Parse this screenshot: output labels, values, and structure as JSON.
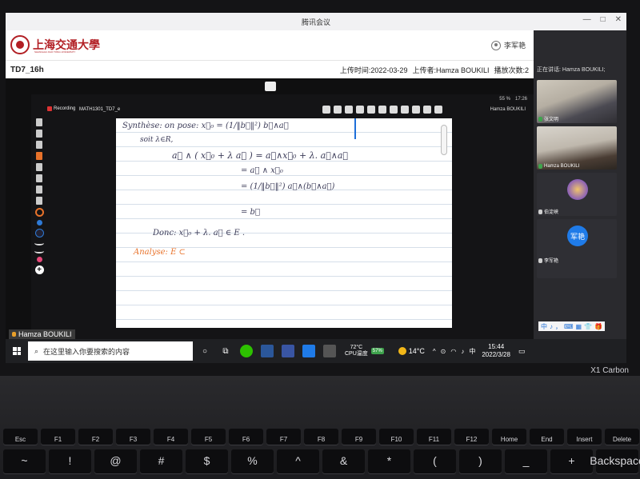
{
  "window": {
    "title": "腾讯会议",
    "controls": [
      "—",
      "□",
      "✕"
    ]
  },
  "header": {
    "logo_text": "上海交通大學",
    "logo_subtext": "SHANGHAI JIAO TONG UNIVERSITY",
    "user_name": "李军艳"
  },
  "info_bar": {
    "course_title": "TD7_16h",
    "upload_time": "上传时间:2022-03-29",
    "uploader": "上传者:Hamza BOUKILI",
    "play_count": "播放次数:2"
  },
  "whiteboard": {
    "recording_label": "Recording",
    "doc_name": "MATH1301_TD7_e",
    "presenter": "Hamza BOUKILI",
    "status_battery": "55 %",
    "status_time": "17:26",
    "math_lines": [
      "Synthèse:  on pose:  x⃗₀ = (1/‖b⃗‖²) b⃗∧a⃗",
      "soit λ∈R,",
      "a⃗ ∧ ( x⃗₀ + λ a⃗ )  =  a⃗∧x⃗₀  +  λ. a⃗∧a⃗",
      "=  a⃗ ∧ x⃗₀",
      "=  (1/‖b⃗‖²)  a⃗∧(b⃗∧a⃗)",
      "=  b⃗",
      "Donc:   x⃗₀ + λ. a⃗  ∈  E .",
      "Analyse:    E ⊂"
    ]
  },
  "participants": {
    "header": "正在讲话: Hamza BOUKILI;",
    "tiles": [
      {
        "name": "张文明"
      },
      {
        "name": "Hamza BOUKILI"
      },
      {
        "name": "伯淀峡"
      },
      {
        "name": "李军艳",
        "avatar_text": "军艳"
      }
    ]
  },
  "share_bar": {
    "name": "Hamza BOUKILI",
    "ime_items": [
      "中",
      "♪",
      "，",
      "⌨",
      "▦",
      "👕",
      "🎁"
    ]
  },
  "taskbar": {
    "search_placeholder": "在这里输入你要搜索的内容",
    "temp_value": "72°C",
    "temp_label": "CPU温度",
    "battery_tag": "57%",
    "weather_temp": "14°C",
    "ime_lang": "中",
    "time": "15:44",
    "date": "2022/3/28"
  },
  "device": {
    "brand": "X1 Carbon"
  },
  "keyboard": {
    "row1": [
      "Esc",
      "F1",
      "F2",
      "F3",
      "F4",
      "F5",
      "F6",
      "F7",
      "F8",
      "F9",
      "F10",
      "F11",
      "F12",
      "Home",
      "End",
      "Insert",
      "Delete"
    ],
    "row2": [
      "~",
      "!",
      "@",
      "#",
      "$",
      "%",
      "^",
      "&",
      "*",
      "(",
      ")",
      "_",
      "+",
      "Backspace"
    ]
  },
  "colors": {
    "accent_red": "#b21f24",
    "pen_blue": "#1e6fd9",
    "pen_orange": "#e8722a",
    "ink": "#3b3b58"
  }
}
